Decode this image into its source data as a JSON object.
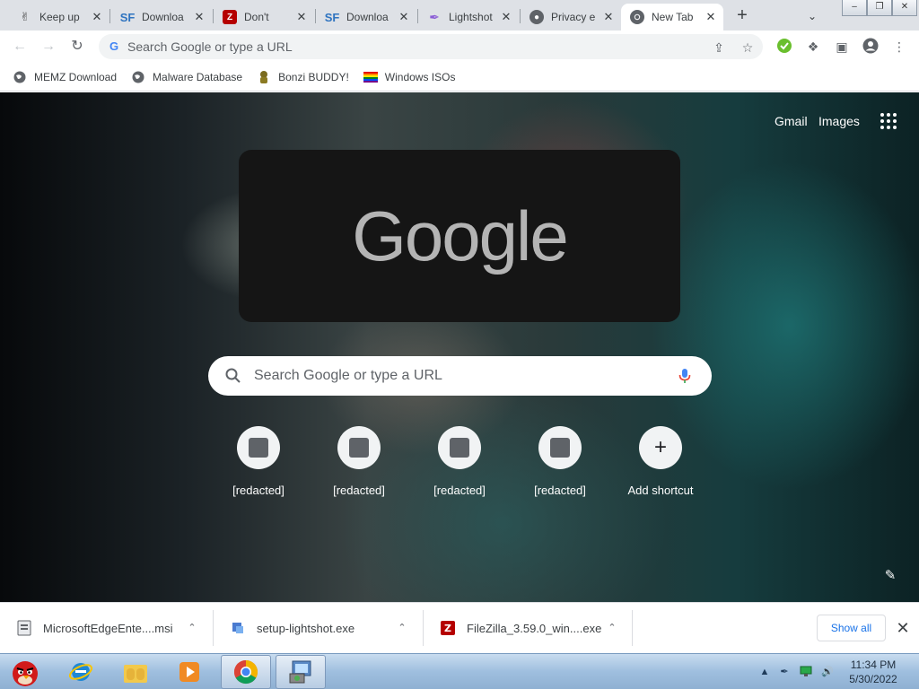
{
  "tabs": [
    {
      "title": "Keep up",
      "favicon": "hand-sign-icon",
      "active": false
    },
    {
      "title": "Downloa",
      "favicon": "sourceforge-icon",
      "active": false
    },
    {
      "title": "Don't",
      "favicon": "filezilla-icon",
      "active": false
    },
    {
      "title": "Downloa",
      "favicon": "sourceforge-icon",
      "active": false
    },
    {
      "title": "Lightshot",
      "favicon": "feather-icon",
      "active": false
    },
    {
      "title": "Privacy e",
      "favicon": "globe-icon",
      "active": false
    },
    {
      "title": "New Tab",
      "favicon": "chrome-icon",
      "active": true
    }
  ],
  "toolbar": {
    "omnibox_placeholder": "Search Google or type a URL"
  },
  "bookmarks": [
    {
      "label": "MEMZ Download",
      "icon": "globe-icon"
    },
    {
      "label": "Malware Database",
      "icon": "globe-icon"
    },
    {
      "label": "Bonzi BUDDY!",
      "icon": "bonzi-icon"
    },
    {
      "label": "Windows ISOs",
      "icon": "rainbow-flag-icon"
    }
  ],
  "ntp": {
    "gmail_label": "Gmail",
    "images_label": "Images",
    "logo_text": "Google",
    "search_placeholder": "Search Google or type a URL",
    "shortcuts": [
      {
        "label": "[redacted]",
        "icon": "redacted-tile-icon"
      },
      {
        "label": "[redacted]",
        "icon": "redacted-tile-icon"
      },
      {
        "label": "[redacted]",
        "icon": "redacted-tile-icon"
      },
      {
        "label": "[redacted]",
        "icon": "redacted-tile-icon"
      },
      {
        "label": "Add shortcut",
        "icon": "plus-icon"
      }
    ]
  },
  "downloads": [
    {
      "filename": "MicrosoftEdgeEnte....msi",
      "icon": "msi-installer-icon"
    },
    {
      "filename": "setup-lightshot.exe",
      "icon": "setup-icon"
    },
    {
      "filename": "FileZilla_3.59.0_win....exe",
      "icon": "filezilla-icon"
    }
  ],
  "download_shelf": {
    "show_all_label": "Show all"
  },
  "taskbar": {
    "time": "11:34 PM",
    "date": "5/30/2022"
  },
  "colors": {
    "tabstrip": "#dee1e6",
    "accent_blue": "#1a73e8",
    "logo_box": "#151515",
    "taskbar": "#9fbfdf"
  }
}
